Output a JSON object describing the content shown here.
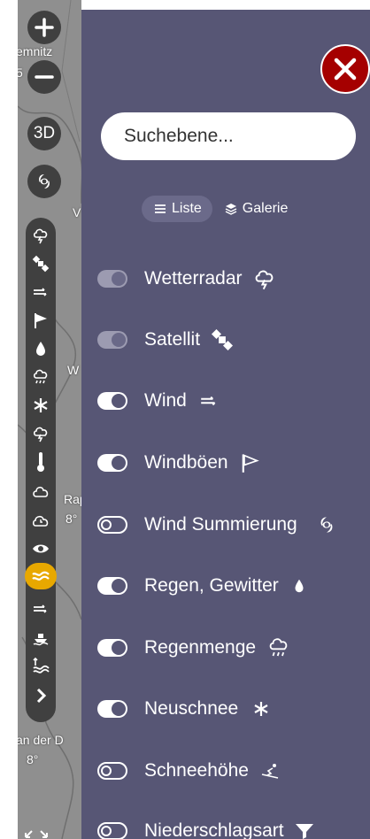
{
  "map": {
    "labels": [
      "emnitz",
      "5",
      "V",
      "W",
      "Rap",
      "8°",
      "an der D",
      "8°"
    ]
  },
  "map_controls": [
    {
      "name": "zoom-in",
      "icon": "plus-icon"
    },
    {
      "name": "zoom-out",
      "icon": "minus-icon"
    },
    {
      "name": "3d",
      "label": "3D"
    },
    {
      "name": "hurricane",
      "icon": "hurricane-icon"
    }
  ],
  "toolbar_icons": [
    "thunder-cloud-icon",
    "satellite-icon",
    "wind-icon",
    "flag-icon",
    "drop-icon",
    "rain-cloud-icon",
    "snowflake-icon",
    "thunder-cloud-icon",
    "thermometer-icon",
    "cloud-icon",
    "cloud-clock-icon",
    "eye-icon",
    "waves-icon",
    "wind-icon",
    "ship-icon",
    "tide-icon",
    "chevron-right-icon"
  ],
  "toolbar_active": "waves-icon",
  "panel": {
    "search": {
      "placeholder": "Suchebene..."
    },
    "views": [
      {
        "label": "Liste",
        "icon": "list-icon",
        "selected": true
      },
      {
        "label": "Galerie",
        "icon": "layers-icon",
        "selected": false
      }
    ],
    "layers": [
      {
        "label": "Wetterradar",
        "state": "dim",
        "icon": "thunder-cloud-icon"
      },
      {
        "label": "Satellit",
        "state": "dim",
        "icon": "satellite-icon"
      },
      {
        "label": "Wind",
        "state": "on",
        "icon": "wind-icon"
      },
      {
        "label": "Windböen",
        "state": "on",
        "icon": "flag-icon"
      },
      {
        "label": "Wind Summierung",
        "state": "off",
        "icon": "hurricane-icon"
      },
      {
        "label": "Regen, Gewitter",
        "state": "on",
        "icon": "drop-icon"
      },
      {
        "label": "Regenmenge",
        "state": "on",
        "icon": "rain-cloud-icon"
      },
      {
        "label": "Neuschnee",
        "state": "on",
        "icon": "snowflake-icon"
      },
      {
        "label": "Schneehöhe",
        "state": "off",
        "icon": "ski-icon"
      },
      {
        "label": "Niederschlagsart",
        "state": "off",
        "icon": "funnel-icon"
      }
    ]
  },
  "colors": {
    "panel_bg": "#575675",
    "close_button": "#a50000",
    "toolbar_bg": "#404040",
    "active_accent": "#e8a800"
  }
}
